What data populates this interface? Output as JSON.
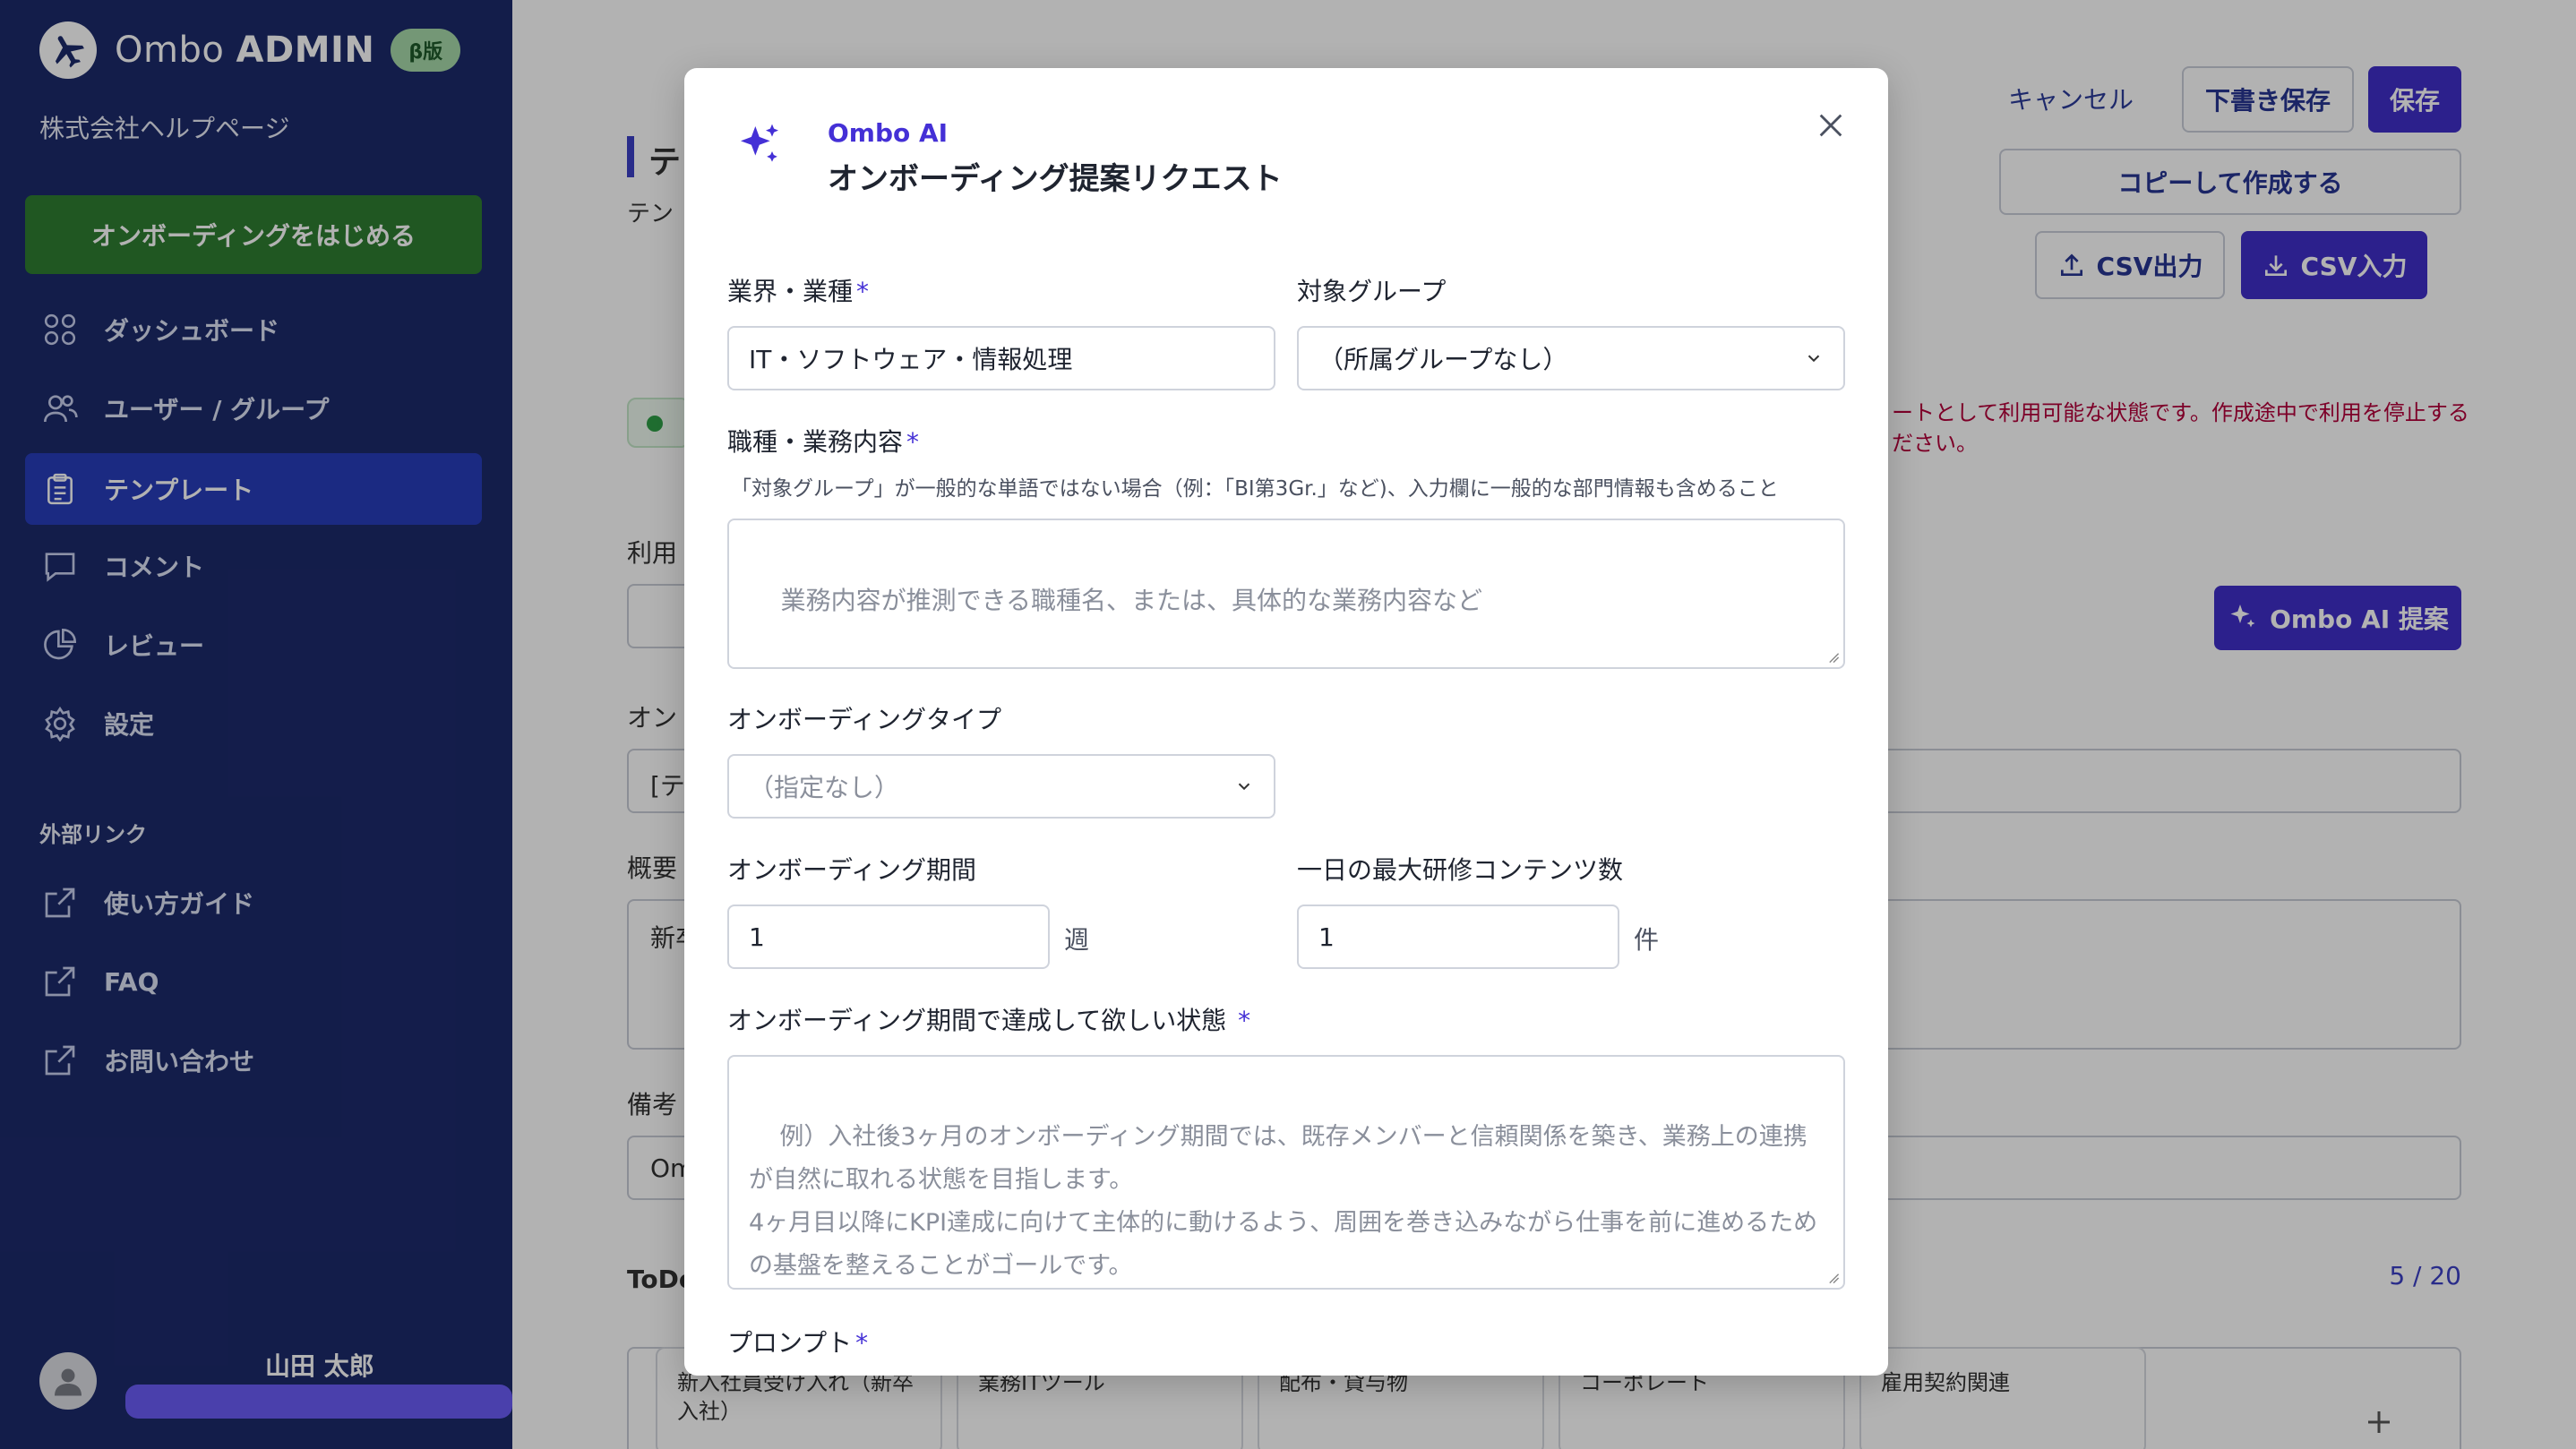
{
  "app": {
    "brand_name": "Ombo",
    "brand_suffix": "ADMIN",
    "beta_badge": "β版",
    "company": "株式会社ヘルプページ"
  },
  "sidebar": {
    "start_button": "オンボーディングをはじめる",
    "items": [
      {
        "label": "ダッシュボード",
        "icon": "grid-icon"
      },
      {
        "label": "ユーザー / グループ",
        "icon": "users-icon"
      },
      {
        "label": "テンプレート",
        "icon": "clipboard-icon",
        "active": true
      },
      {
        "label": "コメント",
        "icon": "comment-icon"
      },
      {
        "label": "レビュー",
        "icon": "pie-chart-icon"
      },
      {
        "label": "設定",
        "icon": "gear-icon"
      }
    ],
    "external_title": "外部リンク",
    "external_links": [
      {
        "label": "使い方ガイド",
        "icon": "external-link-icon"
      },
      {
        "label": "FAQ",
        "icon": "external-link-icon"
      },
      {
        "label": "お問い合わせ",
        "icon": "external-link-icon"
      }
    ],
    "user_name": "山田 太郎"
  },
  "background": {
    "page_title_fragment": "テ",
    "subtitle_fragment": "テン",
    "cancel": "キャンセル",
    "draft_save": "下書き保存",
    "save": "保存",
    "copy_create": "コピーして作成する",
    "csv_export": "CSV出力",
    "csv_import": "CSV入力",
    "warning_line1": "ートとして利用可能な状態です。作成途中で利用を停止する",
    "warning_line2": "ださい。",
    "usage_label_fragment": "利用",
    "ai_suggest": "Ombo AI 提案",
    "onboarding_label_fragment": "オン",
    "onboarding_value_fragment": "[テ",
    "summary_label": "概要",
    "summary_value_fragment": "新卒",
    "notes_label": "備考",
    "notes_value_fragment": "Om",
    "todo_label_fragment": "ToDo",
    "todo_counter": "5 / 20",
    "todo_cards": [
      "新入社員受け入れ（新卒入社）",
      "業務ITツール",
      "配布・貸与物",
      "コーポレート",
      "雇用契約関連"
    ]
  },
  "modal": {
    "ai_label": "Ombo AI",
    "title": "オンボーディング提案リクエスト",
    "industry_label": "業界・業種",
    "industry_value": "IT・ソフトウェア・情報処理",
    "group_label": "対象グループ",
    "group_value": "（所属グループなし）",
    "job_label": "職種・業務内容",
    "job_hint": "「対象グループ」が一般的な単語ではない場合（例：「BI第3Gr.」など)、入力欄に一般的な部門情報も含めること",
    "job_placeholder": "業務内容が推測できる職種名、または、具体的な業務内容など",
    "type_label": "オンボーディングタイプ",
    "type_value": "（指定なし）",
    "period_label": "オンボーディング期間",
    "period_value": "1",
    "period_unit": "週",
    "max_label": "一日の最大研修コンテンツ数",
    "max_value": "1",
    "max_unit": "件",
    "goal_label": "オンボーディング期間で達成して欲しい状態",
    "goal_placeholder": "例）入社後3ヶ月のオンボーディング期間では、既存メンバーと信頼関係を築き、業務上の連携が自然に取れる状態を目指します。\n4ヶ月目以降にKPI達成に向けて主体的に動けるよう、周囲を巻き込みながら仕事を前に進めるための基盤を整えることがゴールです。",
    "prompt_label": "プロンプト",
    "required_mark": "*"
  },
  "colors": {
    "sidebar_bg": "#1c2a6b",
    "active_nav": "#283dbb",
    "primary": "#3f2ec9",
    "start_button": "#2e7d32",
    "ai_accent": "#4430d6"
  }
}
